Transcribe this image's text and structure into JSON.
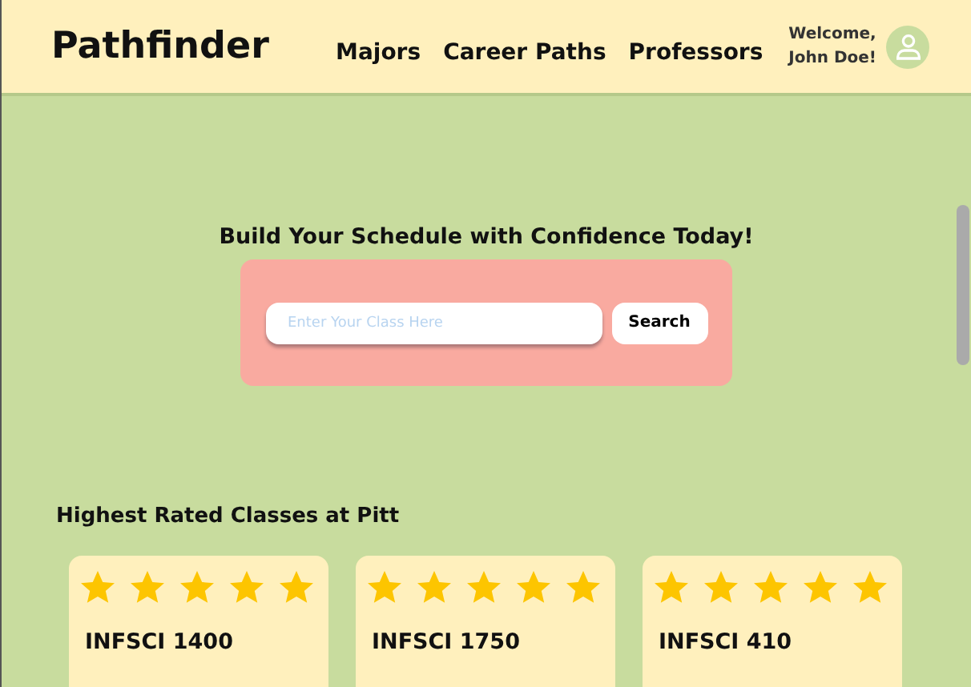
{
  "header": {
    "logo": "Pathfinder",
    "nav": [
      "Majors",
      "Career Paths",
      "Professors"
    ],
    "greeting": [
      "Welcome,",
      "John Doe!"
    ]
  },
  "hero": {
    "tagline": "Build Your Schedule with Confidence Today!",
    "search": {
      "placeholder": "Enter Your Class Here",
      "button": "Search"
    }
  },
  "top_classes": {
    "heading": "Highest Rated Classes at Pitt",
    "cards": [
      {
        "stars": 5,
        "title": "INFSCI 1400"
      },
      {
        "stars": 5,
        "title": "INFSCI 1750"
      },
      {
        "stars": 5,
        "title": "INFSCI 410"
      }
    ]
  }
}
